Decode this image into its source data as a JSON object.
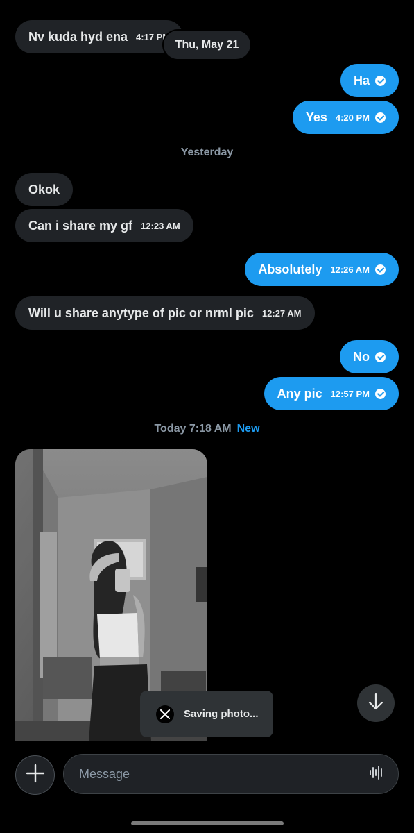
{
  "messages": [
    {
      "id": "m1",
      "dir": "in",
      "text": "Nv kuda hyd ena",
      "time": "4:17 PM"
    },
    {
      "id": "m2",
      "dir": "out",
      "text": "Ha",
      "time": ""
    },
    {
      "id": "m3",
      "dir": "out",
      "text": "Yes",
      "time": "4:20 PM"
    },
    {
      "id": "m4",
      "dir": "in",
      "text": "Okok",
      "time": ""
    },
    {
      "id": "m5",
      "dir": "in",
      "text": "Can i share my gf",
      "time": "12:23 AM"
    },
    {
      "id": "m6",
      "dir": "out",
      "text": "Absolutely",
      "time": "12:26 AM"
    },
    {
      "id": "m7",
      "dir": "in",
      "text": "Will u share anytype of pic or nrml pic",
      "time": "12:27 AM"
    },
    {
      "id": "m8",
      "dir": "out",
      "text": "No",
      "time": ""
    },
    {
      "id": "m9",
      "dir": "out",
      "text": "Any pic",
      "time": "12:57 PM"
    }
  ],
  "date_chip": "Thu, May 21",
  "separators": {
    "yesterday": "Yesterday",
    "today": "Today 7:18 AM",
    "new_label": "New"
  },
  "toast": {
    "text": "Saving photo...",
    "icon": "x-logo-icon"
  },
  "composer": {
    "placeholder": "Message"
  },
  "icons": {
    "plus": "plus-icon",
    "voice": "waveform-icon",
    "scroll": "arrow-down-icon",
    "read": "check-circle-icon"
  },
  "colors": {
    "accent": "#1d9bf0",
    "incoming": "#202327",
    "background": "#000000"
  }
}
